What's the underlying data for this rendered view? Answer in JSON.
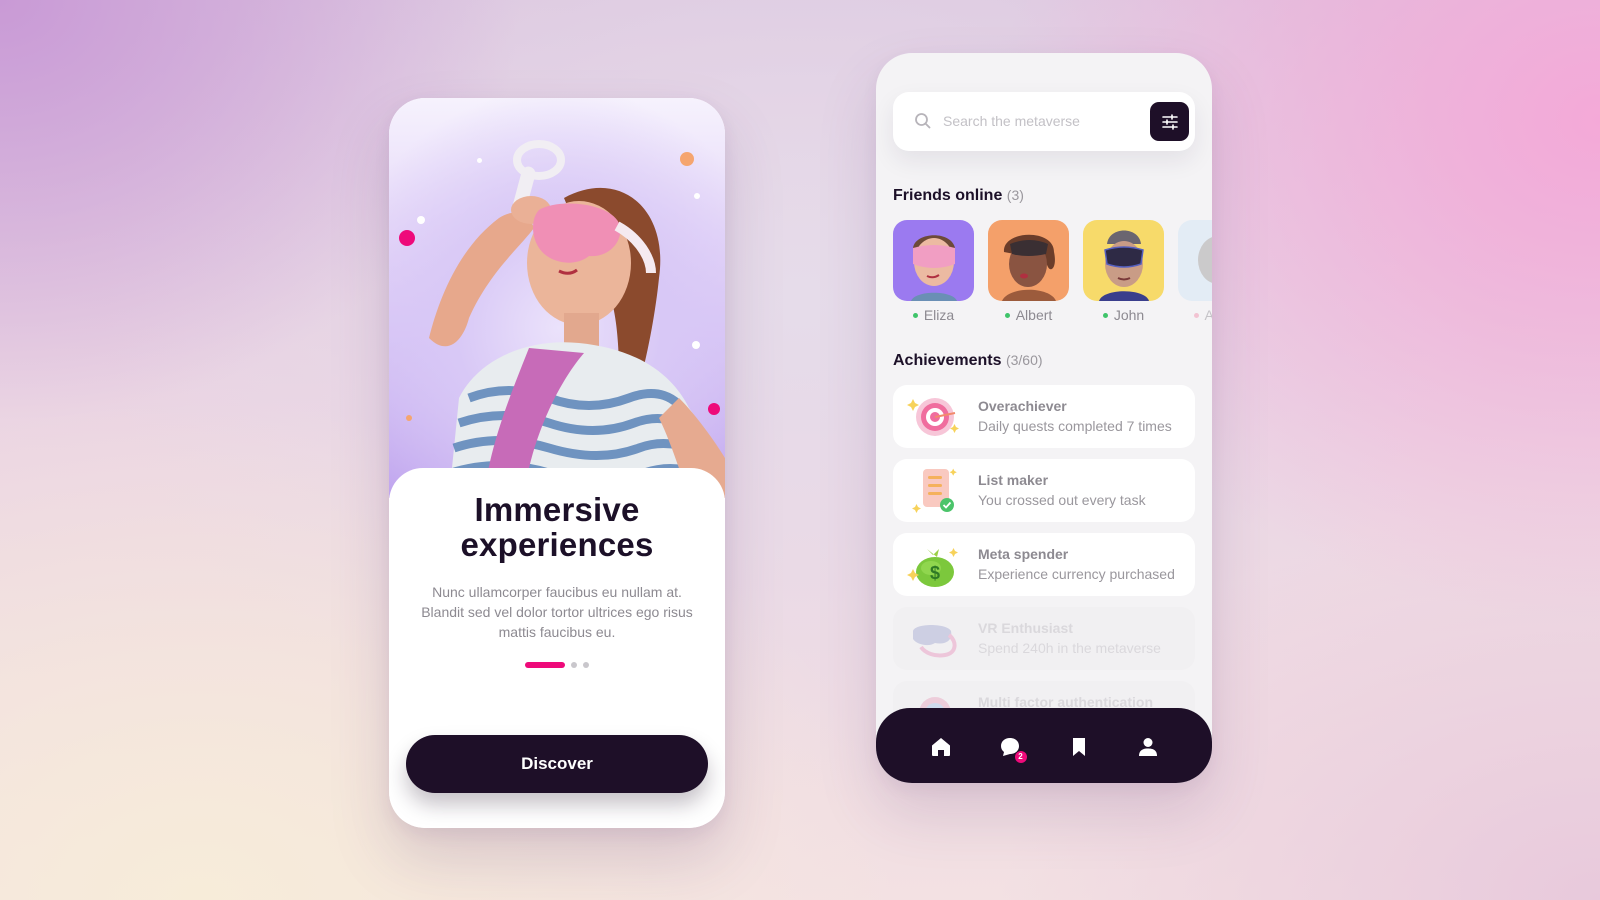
{
  "onboarding": {
    "title_line1": "Immersive",
    "title_line2": "experiences",
    "description": "Nunc ullamcorper faucibus eu nullam at. Blandit sed vel dolor tortor ultrices ego risus mattis faucibus eu.",
    "pager": {
      "total": 3,
      "active_index": 0
    },
    "cta_label": "Discover",
    "hero_image": "woman-in-vr-headset-illustration"
  },
  "home": {
    "search": {
      "placeholder": "Search the metaverse",
      "value": "",
      "icon": "search-icon",
      "filter_icon": "sliders-icon"
    },
    "friends": {
      "title": "Friends online",
      "count_label": "(3)",
      "items": [
        {
          "name": "Eliza",
          "status": "online",
          "status_color": "#3fc46a",
          "bg": "#9b7af0"
        },
        {
          "name": "Albert",
          "status": "online",
          "status_color": "#3fc46a",
          "bg": "#f4a06a"
        },
        {
          "name": "John",
          "status": "online",
          "status_color": "#3fc46a",
          "bg": "#f7da6a"
        },
        {
          "name": "And…",
          "status": "offline",
          "status_color": "#f08aa8",
          "bg": "#cfe4f6"
        }
      ]
    },
    "achievements": {
      "title": "Achievements",
      "count_label": "(3/60)",
      "items": [
        {
          "title": "Overachiever",
          "description": "Daily quests completed 7 times",
          "icon": "target-icon",
          "unlocked": true
        },
        {
          "title": "List maker",
          "description": "You crossed out every task",
          "icon": "checklist-icon",
          "unlocked": true
        },
        {
          "title": "Meta spender",
          "description": "Experience currency purchased",
          "icon": "money-bag-icon",
          "unlocked": true
        },
        {
          "title": "VR Enthusiast",
          "description": "Spend 240h in the metaverse",
          "icon": "vr-headset-icon",
          "unlocked": false
        },
        {
          "title": "Multi factor authentication",
          "description": "",
          "icon": "shield-icon",
          "unlocked": false
        }
      ]
    },
    "nav": {
      "items": [
        {
          "name": "home",
          "icon": "home-icon"
        },
        {
          "name": "messages",
          "icon": "chat-icon",
          "badge": "2"
        },
        {
          "name": "saved",
          "icon": "bookmark-icon"
        },
        {
          "name": "profile",
          "icon": "user-icon"
        }
      ]
    }
  },
  "colors": {
    "brand_dark": "#1e0f28",
    "accent_pink": "#ee0a7a",
    "online_green": "#3fc46a",
    "muted_text": "#8d8a91"
  }
}
